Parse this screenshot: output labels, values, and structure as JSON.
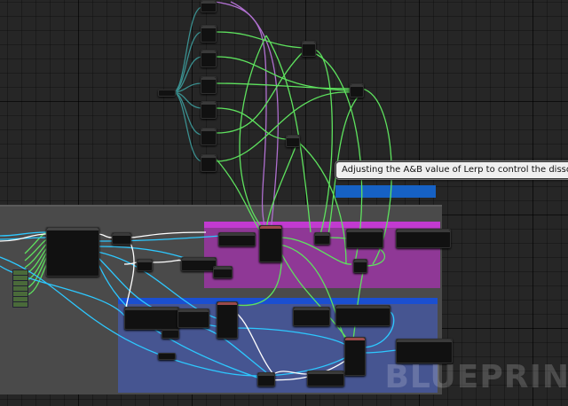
{
  "comment_bubble": {
    "text": "Adjusting the A&B value of Lerp to control the dissolve"
  },
  "watermark": {
    "text": "BLUEPRIN"
  },
  "colors": {
    "exec": "#ffffff",
    "float": "#5ee25e",
    "vector": "#2dc8ff",
    "struct": "#3a8f8f",
    "object": "#b070d0"
  }
}
